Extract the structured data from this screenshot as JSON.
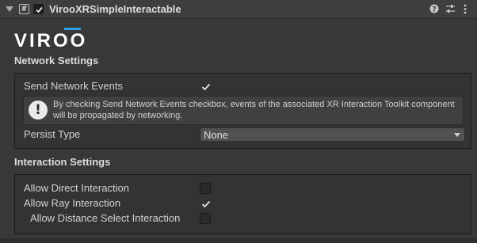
{
  "header": {
    "component_title": "VirooXRSimpleInteractable",
    "script_icon_glyph": "#",
    "enabled": true
  },
  "logo": {
    "text": "VIROO",
    "accent_color": "#2aa3e8"
  },
  "network_settings": {
    "title": "Network Settings",
    "send_network_events": {
      "label": "Send Network Events",
      "checked": true
    },
    "help_text": "By checking Send Network Events checkbox, events of the associated XR Interaction Toolkit component will be propagated by networking.",
    "persist_type": {
      "label": "Persist Type",
      "value": "None"
    }
  },
  "interaction_settings": {
    "title": "Interaction Settings",
    "allow_direct": {
      "label": "Allow Direct Interaction",
      "checked": false
    },
    "allow_ray": {
      "label": "Allow Ray Interaction",
      "checked": true
    },
    "allow_distance_select": {
      "label": "Allow Distance Select Interaction",
      "checked": false
    }
  },
  "icons": [
    "foldout-arrow-icon",
    "script-icon",
    "help-icon",
    "preset-sliders-icon",
    "kebab-menu-icon",
    "warning-icon",
    "check-icon"
  ]
}
